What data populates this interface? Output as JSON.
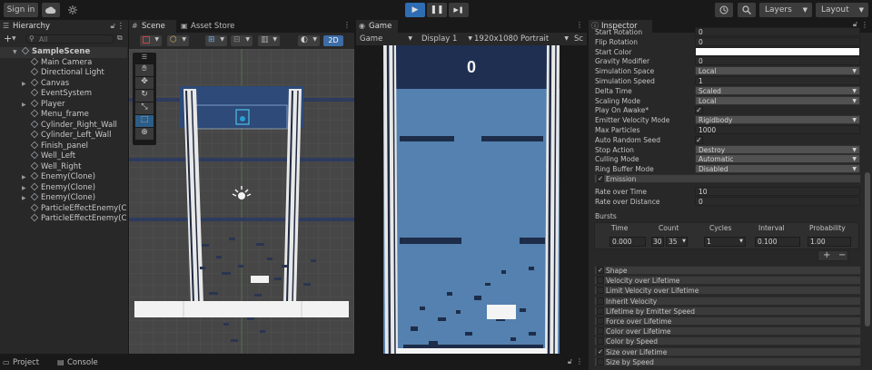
{
  "toolbar": {
    "sign_in": "Sign in",
    "cloud_icon": "cloud-icon",
    "collab_icon": "collab-icon",
    "play_icon": "▶",
    "pause_icon": "❚❚",
    "step_icon": "▶❚",
    "history_icon": "history-icon",
    "search_icon": "search-icon",
    "layers": "Layers",
    "layout": "Layout"
  },
  "hierarchy": {
    "tab": "Hierarchy",
    "add": "+",
    "search_placeholder": "All",
    "items": [
      {
        "label": "SampleScene",
        "depth": 0,
        "expand": "▼",
        "scene": true
      },
      {
        "label": "Main Camera",
        "depth": 1,
        "expand": ""
      },
      {
        "label": "Directional Light",
        "depth": 1,
        "expand": ""
      },
      {
        "label": "Canvas",
        "depth": 1,
        "expand": "▶"
      },
      {
        "label": "EventSystem",
        "depth": 1,
        "expand": ""
      },
      {
        "label": "Player",
        "depth": 1,
        "expand": "▶"
      },
      {
        "label": "Menu_frame",
        "depth": 1,
        "expand": ""
      },
      {
        "label": "Cylinder_Right_Wall",
        "depth": 1,
        "expand": ""
      },
      {
        "label": "Cylinder_Left_Wall",
        "depth": 1,
        "expand": ""
      },
      {
        "label": "Finish_panel",
        "depth": 1,
        "expand": ""
      },
      {
        "label": "Well_Left",
        "depth": 1,
        "expand": ""
      },
      {
        "label": "Well_Right",
        "depth": 1,
        "expand": ""
      },
      {
        "label": "Enemy(Clone)",
        "depth": 1,
        "expand": "▶"
      },
      {
        "label": "Enemy(Clone)",
        "depth": 1,
        "expand": "▶"
      },
      {
        "label": "Enemy(Clone)",
        "depth": 1,
        "expand": "▶"
      },
      {
        "label": "ParticleEffectEnemy(C",
        "depth": 1,
        "expand": ""
      },
      {
        "label": "ParticleEffectEnemy(C",
        "depth": 1,
        "expand": ""
      }
    ]
  },
  "scene": {
    "tab_scene": "Scene",
    "tab_asset": "Asset Store",
    "mode_2d": "2D"
  },
  "game": {
    "tab": "Game",
    "display_mode": "Game",
    "display": "Display 1",
    "resolution": "1920x1080 Portrait",
    "scale": "Sc",
    "score": "0"
  },
  "inspector": {
    "tab": "Inspector",
    "rows": [
      {
        "label": "Start Rotation",
        "value": "0",
        "kind": "text"
      },
      {
        "label": "Flip Rotation",
        "value": "0",
        "kind": "text"
      },
      {
        "label": "Start Color",
        "value": "",
        "kind": "color"
      },
      {
        "label": "Gravity Modifier",
        "value": "0",
        "kind": "text"
      },
      {
        "label": "Simulation Space",
        "value": "Local",
        "kind": "dd"
      },
      {
        "label": "Simulation Speed",
        "value": "1",
        "kind": "text"
      },
      {
        "label": "Delta Time",
        "value": "Scaled",
        "kind": "dd"
      },
      {
        "label": "Scaling Mode",
        "value": "Local",
        "kind": "dd"
      },
      {
        "label": "Play On Awake*",
        "value": "✓",
        "kind": "check"
      },
      {
        "label": "Emitter Velocity Mode",
        "value": "Rigidbody",
        "kind": "dd"
      },
      {
        "label": "Max Particles",
        "value": "1000",
        "kind": "text"
      },
      {
        "label": "Auto Random Seed",
        "value": "✓",
        "kind": "check"
      },
      {
        "label": "Stop Action",
        "value": "Destroy",
        "kind": "dd"
      },
      {
        "label": "Culling Mode",
        "value": "Automatic",
        "kind": "dd"
      },
      {
        "label": "Ring Buffer Mode",
        "value": "Disabled",
        "kind": "dd"
      }
    ],
    "emission": {
      "title": "Emission",
      "rate_time_label": "Rate over Time",
      "rate_time_value": "10",
      "rate_distance_label": "Rate over Distance",
      "rate_distance_value": "0",
      "bursts_label": "Bursts",
      "burst_headers": [
        "Time",
        "Count",
        "Cycles",
        "Interval",
        "Probability"
      ],
      "burst_time": "0.000",
      "burst_count_min": "30",
      "burst_count_max": "35",
      "burst_cycles": "1",
      "burst_interval": "0.100",
      "burst_probability": "1.00",
      "add": "+",
      "remove": "−"
    },
    "modules": [
      {
        "label": "Shape",
        "checked": "✓"
      },
      {
        "label": "Velocity over Lifetime",
        "checked": ""
      },
      {
        "label": "Limit Velocity over Lifetime",
        "checked": ""
      },
      {
        "label": "Inherit Velocity",
        "checked": ""
      },
      {
        "label": "Lifetime by Emitter Speed",
        "checked": ""
      },
      {
        "label": "Force over Lifetime",
        "checked": ""
      },
      {
        "label": "Color over Lifetime",
        "checked": ""
      },
      {
        "label": "Color by Speed",
        "checked": ""
      },
      {
        "label": "Size over Lifetime",
        "checked": "✓"
      },
      {
        "label": "Size by Speed",
        "checked": ""
      }
    ]
  },
  "bottom": {
    "project": "Project",
    "console": "Console"
  },
  "colors": {
    "game_sky": "#5481af",
    "game_top": "#1f2f52",
    "tile": "#1d2d49",
    "selection": "#2c5d87"
  }
}
